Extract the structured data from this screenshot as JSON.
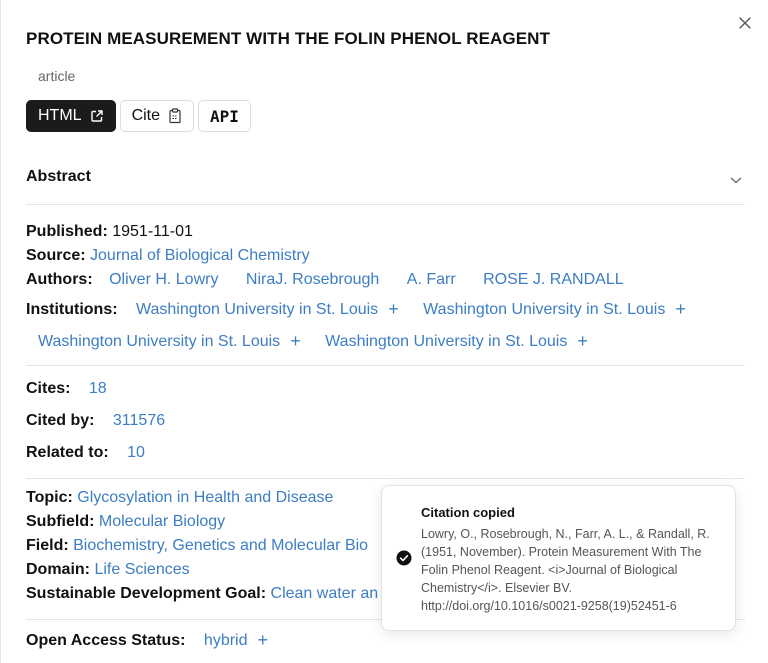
{
  "title": "PROTEIN MEASUREMENT WITH THE FOLIN PHENOL REAGENT",
  "type": "article",
  "buttons": {
    "html": "HTML",
    "cite": "Cite",
    "api": "API"
  },
  "abstract_label": "Abstract",
  "published": {
    "label": "Published:",
    "value": "1951-11-01"
  },
  "source": {
    "label": "Source:",
    "value": "Journal of Biological Chemistry"
  },
  "authors": {
    "label": "Authors:",
    "items": [
      "Oliver H. Lowry",
      "NiraJ. Rosebrough",
      "A. Farr",
      "ROSE J. RANDALL"
    ]
  },
  "institutions": {
    "label": "Institutions:",
    "items": [
      "Washington University in St. Louis",
      "Washington University in St. Louis",
      "Washington University in St. Louis",
      "Washington University in St. Louis"
    ]
  },
  "cites": {
    "label": "Cites:",
    "value": "18"
  },
  "cited_by": {
    "label": "Cited by:",
    "value": "311576"
  },
  "related_to": {
    "label": "Related to:",
    "value": "10"
  },
  "topic": {
    "label": "Topic:",
    "value": "Glycosylation in Health and Disease"
  },
  "subfield": {
    "label": "Subfield:",
    "value": "Molecular Biology"
  },
  "field": {
    "label": "Field:",
    "value": "Biochemistry, Genetics and Molecular Bio"
  },
  "domain": {
    "label": "Domain:",
    "value": "Life Sciences"
  },
  "sdg": {
    "label": "Sustainable Development Goal:",
    "value": "Clean water an"
  },
  "oa_status": {
    "label": "Open Access Status:",
    "value": "hybrid"
  },
  "toast": {
    "title": "Citation copied",
    "message": "Lowry, O., Rosebrough, N., Farr, A. L., & Randall, R. (1951, November). Protein Measurement With The Folin Phenol Reagent. <i>Journal of Biological Chemistry</i>. Elsevier BV. http://doi.org/10.1016/s0021-9258(19)52451-6"
  },
  "colors": {
    "link": "#3c7dc4",
    "dark_button": "#1b1b1b"
  },
  "icons": [
    "close-icon",
    "external-link-icon",
    "clipboard-icon",
    "chevron-down-icon",
    "plus-icon",
    "check-circle-icon"
  ]
}
